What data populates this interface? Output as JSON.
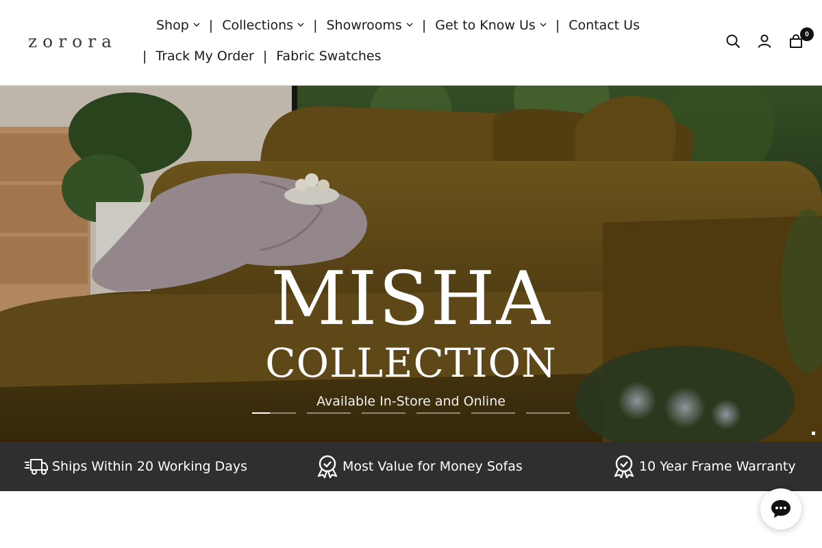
{
  "brand": {
    "logo_text": "zorora"
  },
  "nav": {
    "row1": [
      {
        "label": "Shop",
        "has_dropdown": true
      },
      {
        "label": "Collections",
        "has_dropdown": true
      },
      {
        "label": "Showrooms",
        "has_dropdown": true
      },
      {
        "label": "Get to Know Us",
        "has_dropdown": true
      },
      {
        "label": "Contact Us",
        "has_dropdown": false
      }
    ],
    "row2": [
      {
        "label": "Track My Order"
      },
      {
        "label": "Fabric Swatches"
      }
    ],
    "separator": "|"
  },
  "header_icons": {
    "search": "search-icon",
    "account": "account-icon",
    "cart": "cart-icon",
    "cart_count": "0"
  },
  "hero": {
    "title": "MISHA",
    "subtitle": "COLLECTION",
    "tagline": "Available In-Store and Online",
    "slides_count": 6,
    "active_slide": 0,
    "active_progress": 0.4
  },
  "features": [
    {
      "icon": "delivery-truck-icon",
      "text": "Ships Within 20 Working Days"
    },
    {
      "icon": "award-ribbon-icon",
      "text": "Most Value for Money Sofas"
    },
    {
      "icon": "award-ribbon-icon",
      "text": "10 Year Frame Warranty"
    }
  ],
  "chat": {
    "icon": "chat-bubble-icon"
  }
}
